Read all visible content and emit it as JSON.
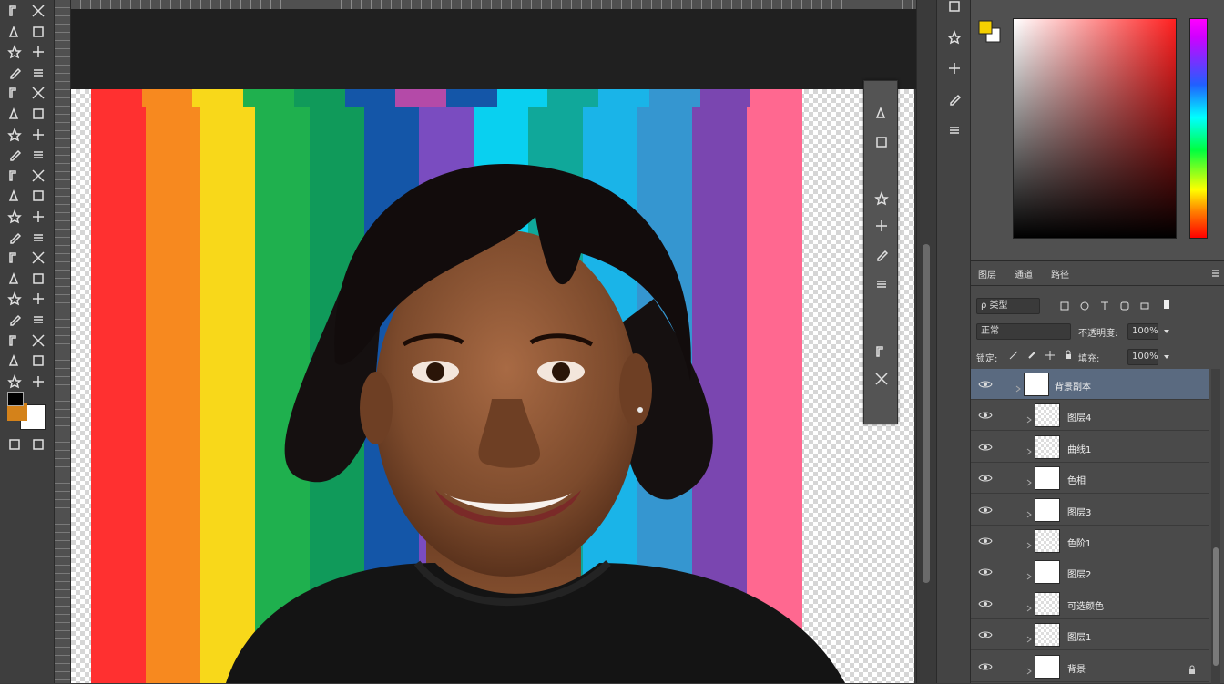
{
  "toolbox": {
    "tools": [
      "move-icon",
      "marquee-icon",
      "lasso-icon",
      "polygon-lasso-icon",
      "magic-wand-icon",
      "quick-select-icon",
      "crop-icon",
      "slice-icon",
      "eyedropper-icon",
      "ruler-icon",
      "healing-icon",
      "patch-icon",
      "brush-icon",
      "pencil-icon",
      "clone-stamp-icon",
      "pattern-stamp-icon",
      "history-brush-icon",
      "art-history-icon",
      "eraser-icon",
      "bg-eraser-icon",
      "gradient-icon",
      "paint-bucket-icon",
      "blur-icon",
      "sharpen-icon",
      "dodge-icon",
      "burn-icon",
      "pen-icon",
      "freeform-pen-icon",
      "type-icon",
      "vertical-type-icon",
      "path-select-icon",
      "direct-select-icon",
      "shape-icon",
      "custom-shape-icon",
      "hand-icon",
      "rotate-view-icon",
      "zoom-icon",
      "notes-icon"
    ],
    "foreground_color": "#000000",
    "background_color": "#ffffff",
    "accent_swatch": "#d4821a"
  },
  "canvas": {
    "stripe_colors": [
      "#ff3030",
      "#f7891f",
      "#f8d81a",
      "#1fb04e",
      "#109a5a",
      "#1456a8",
      "#7a4cc0",
      "#09d0f0",
      "#10a89a",
      "#1ab4e8",
      "#3596d0",
      "#7a46b0",
      "#ff6890"
    ],
    "top_accent_colors": [
      "#ff3030",
      "#f7891f",
      "#f8d81a",
      "#1fb04e",
      "#109a5a",
      "#1456a8",
      "#b44aa8",
      "#1456a8",
      "#09d0f0",
      "#10a89a",
      "#1ab4e8",
      "#3596d0",
      "#7a46b0",
      "#ff6890"
    ]
  },
  "float_tools": [
    "scissors-icon",
    "frame-icon",
    "type-path-icon",
    "align-icon",
    "star-icon",
    "pin-icon",
    "grid-icon",
    "ramp-icon"
  ],
  "icon_column": [
    "history-icon",
    "swatches-icon",
    "properties-icon",
    "adjust-icon",
    "brush-settings-icon"
  ],
  "color_panel": {
    "foreground": "#f5d000",
    "background": "#ffffff",
    "field_hue": "#ff2020"
  },
  "layers_panel": {
    "tabs": [
      "图层",
      "通道",
      "路径"
    ],
    "filter_kind": "ρ 类型",
    "blend_mode": "正常",
    "opacity_label": "不透明度:",
    "opacity_value": "100%",
    "lock_label": "锁定:",
    "fill_label": "填充:",
    "fill_value": "100%",
    "layers": [
      {
        "name": "背景副本",
        "selected": true,
        "solid": true
      },
      {
        "name": "图层4",
        "selected": false,
        "solid": false
      },
      {
        "name": "曲线1",
        "selected": false,
        "solid": false
      },
      {
        "name": "色相",
        "selected": false,
        "solid": true
      },
      {
        "name": "图层3",
        "selected": false,
        "solid": true
      },
      {
        "name": "色阶1",
        "selected": false,
        "solid": false
      },
      {
        "name": "图层2",
        "selected": false,
        "solid": true
      },
      {
        "name": "可选颜色",
        "selected": false,
        "solid": false
      },
      {
        "name": "图层1",
        "selected": false,
        "solid": false
      },
      {
        "name": "背景",
        "selected": false,
        "solid": true
      }
    ]
  }
}
